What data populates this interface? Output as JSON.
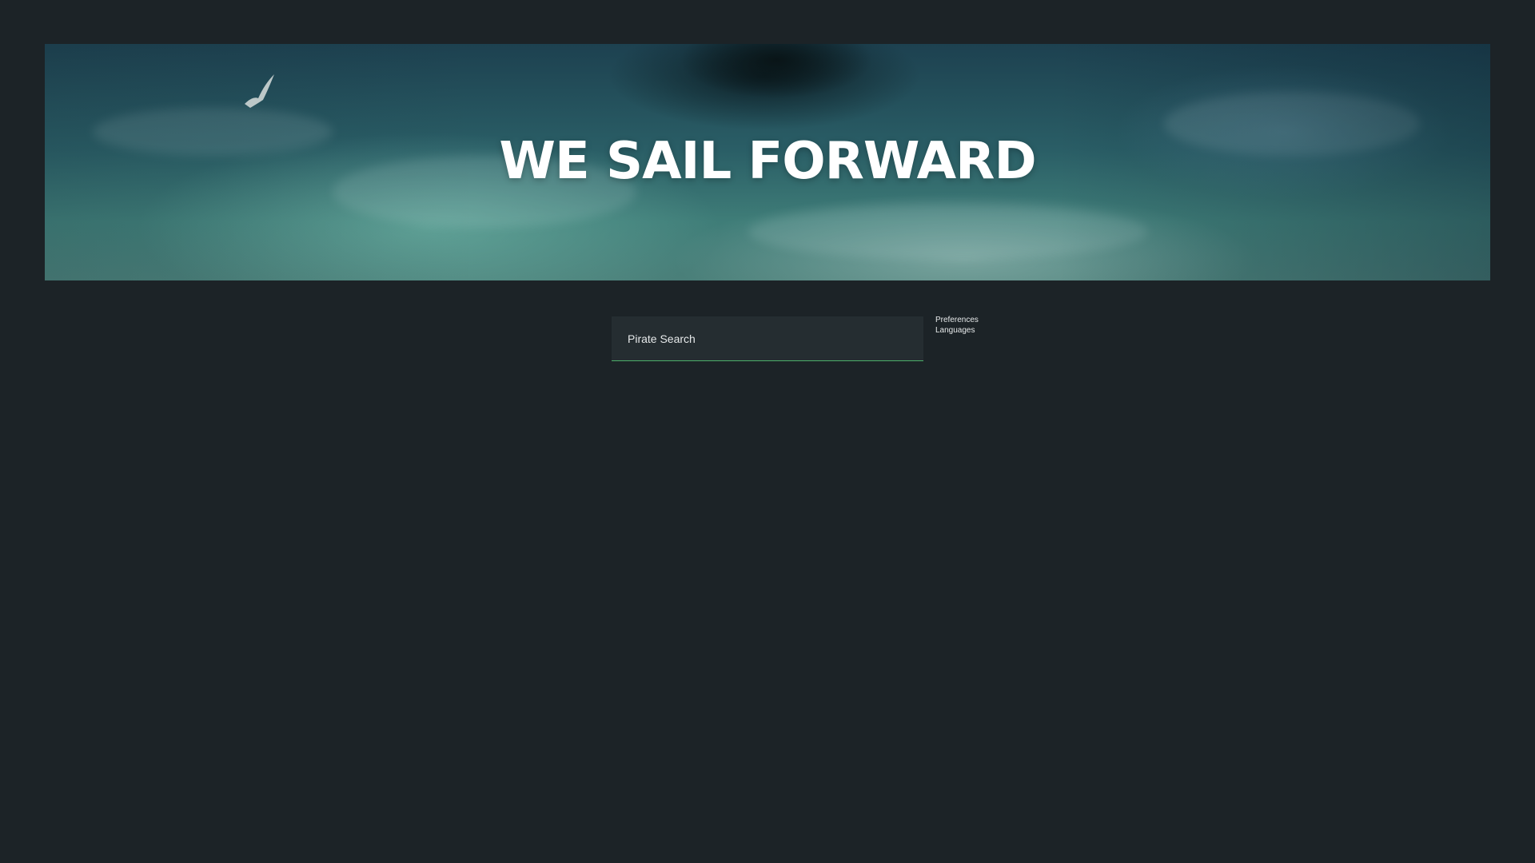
{
  "hero": {
    "title": "WE SAIL FORWARD"
  },
  "search": {
    "placeholder": "Pirate Search",
    "value": ""
  },
  "links": {
    "preferences": "Preferences",
    "languages": "Languages"
  },
  "colors": {
    "background": "#1c2327",
    "search_bg": "#252d31",
    "accent": "#4caf6a",
    "text": "#e6e9ea"
  },
  "icons": {
    "gull": "seagull-icon"
  }
}
